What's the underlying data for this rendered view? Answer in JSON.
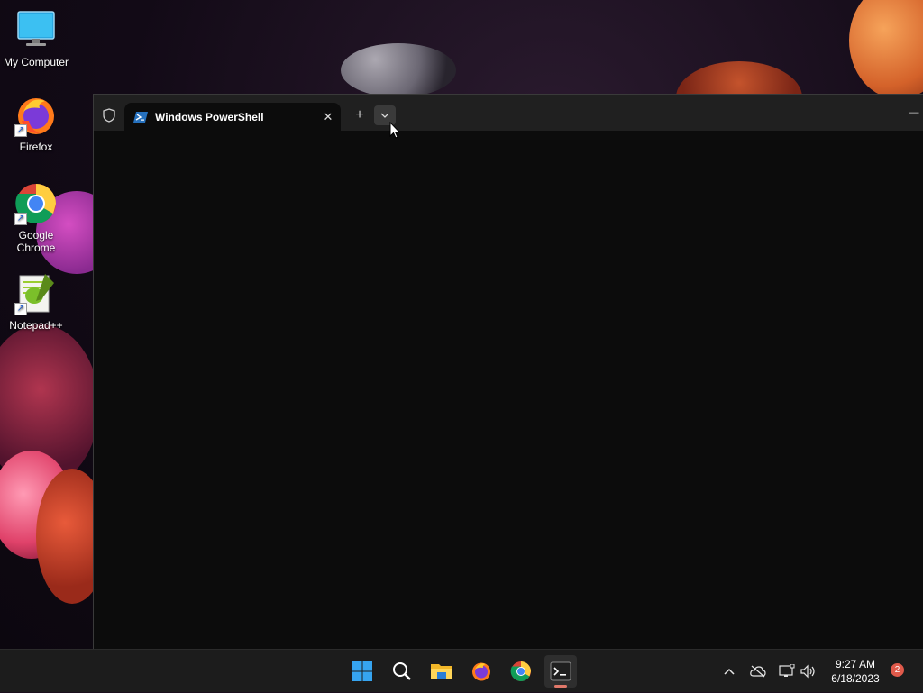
{
  "desktop": {
    "icons": [
      {
        "label": "My Computer",
        "icon": "monitor-icon"
      },
      {
        "label": "Firefox",
        "icon": "firefox-icon"
      },
      {
        "label": "Google Chrome",
        "icon": "chrome-icon"
      },
      {
        "label": "Notepad++",
        "icon": "notepadpp-icon"
      }
    ]
  },
  "terminal": {
    "tab_title": "Windows PowerShell",
    "new_tab_symbol": "+",
    "close_tab_symbol": "✕",
    "minimize_symbol": "—"
  },
  "taskbar": {
    "apps": [
      "start-icon",
      "search-icon",
      "file-explorer-icon",
      "firefox-icon",
      "chrome-icon",
      "terminal-icon"
    ],
    "time": "9:27 AM",
    "date": "6/18/2023",
    "notification_count": "2"
  },
  "colors": {
    "terminal_bg": "#0c0c0c",
    "titlebar_bg": "#202020",
    "taskbar_bg": "#1c1c1c",
    "badge": "#e05a4b",
    "active_indicator": "#e0786a"
  }
}
